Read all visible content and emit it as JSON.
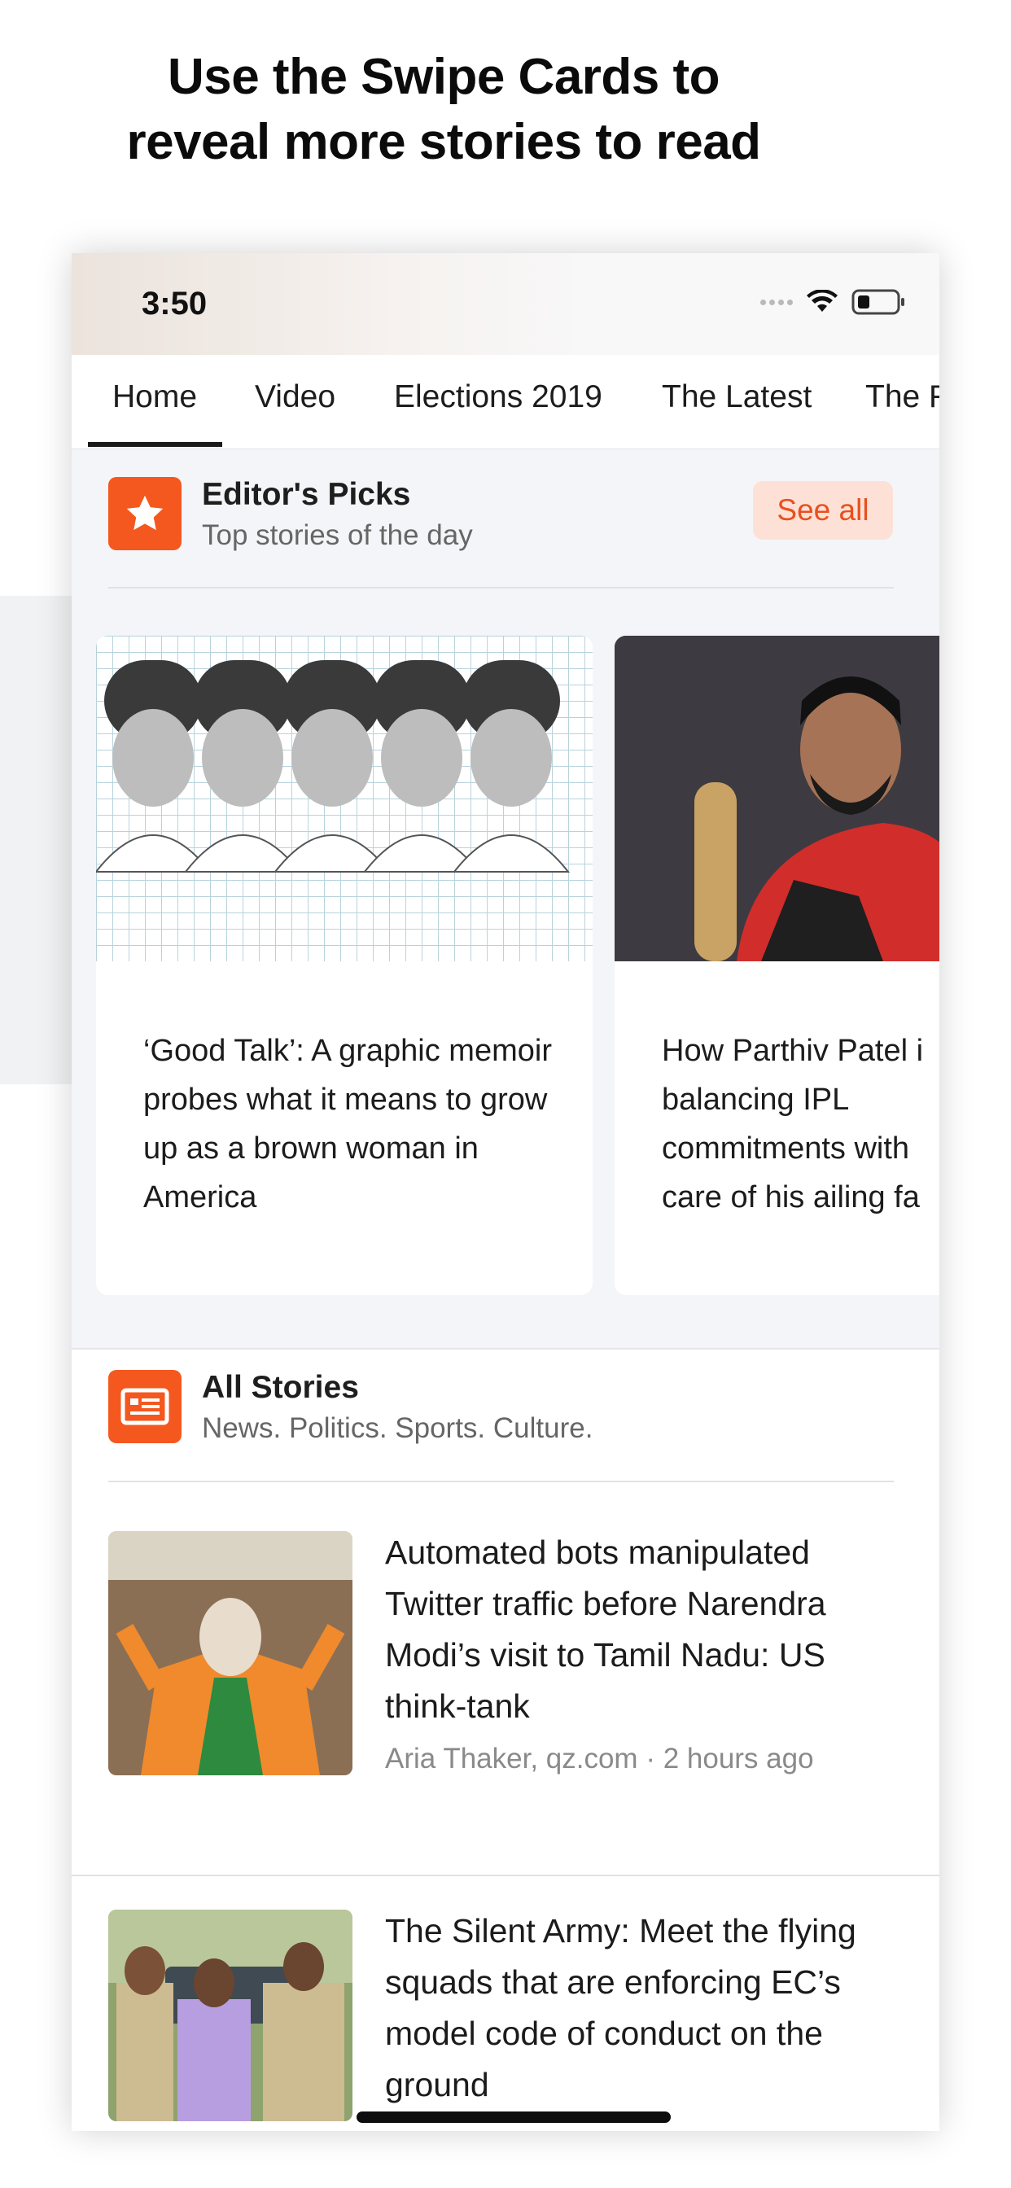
{
  "promo": {
    "line1": "Use the Swipe Cards to",
    "line2": "reveal more stories to read"
  },
  "status_bar": {
    "time": "3:50"
  },
  "tabs": [
    {
      "label": "Home",
      "active": true
    },
    {
      "label": "Video"
    },
    {
      "label": "Elections 2019"
    },
    {
      "label": "The Latest"
    },
    {
      "label": "The R"
    }
  ],
  "editors_picks": {
    "title": "Editor's Picks",
    "subtitle": "Top stories of the day",
    "see_all": "See all",
    "cards": [
      {
        "headline": "‘Good Talk’: A graphic memoir probes what it means to grow up as a brown woman in America"
      },
      {
        "headline": "How Parthiv Patel i balancing IPL commitments with care of his ailing fa"
      }
    ]
  },
  "all_stories": {
    "title": "All Stories",
    "subtitle": "News. Politics. Sports. Culture.",
    "items": [
      {
        "headline": "Automated bots manipulated Twitter traffic before Narendra Modi’s visit to Tamil Nadu: US think-tank",
        "meta": "Aria Thaker, qz.com · 2 hours ago"
      },
      {
        "headline": "The Silent Army: Meet the flying squads that are enforcing EC’s model code of conduct on the ground"
      }
    ]
  },
  "colors": {
    "accent": "#f4581f",
    "see_all_bg": "#fde1d7",
    "text": "#1c1c1c",
    "muted": "#8a8a8a"
  }
}
